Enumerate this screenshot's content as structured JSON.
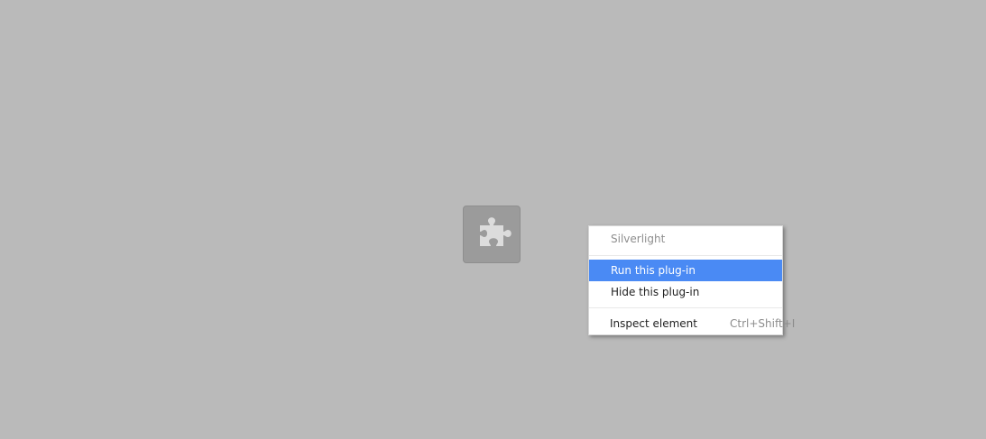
{
  "plugin": {
    "icon": "puzzle-piece-icon"
  },
  "context_menu": {
    "title": "Silverlight",
    "items": [
      {
        "label": "Run this plug-in",
        "highlighted": true
      },
      {
        "label": "Hide this plug-in"
      },
      {
        "label": "Inspect element",
        "shortcut": "Ctrl+Shift+I"
      }
    ]
  },
  "colors": {
    "background": "#bababa",
    "highlight": "#4a8af4",
    "menu_background": "#ffffff"
  }
}
